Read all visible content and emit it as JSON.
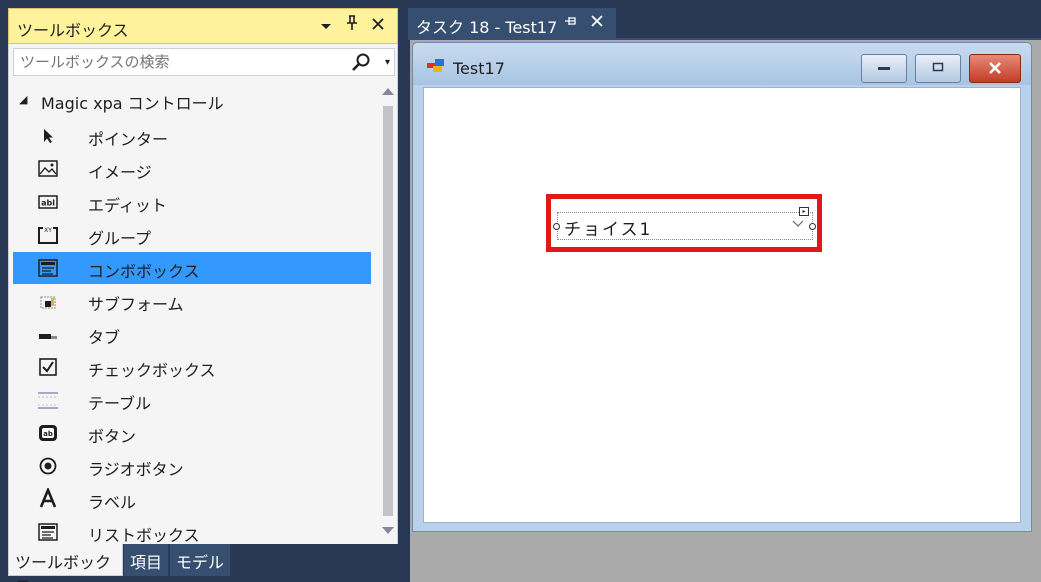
{
  "toolbox": {
    "title": "ツールボックス",
    "search_placeholder": "ツールボックスの検索",
    "group_label": "Magic xpa コントロール",
    "items": [
      {
        "label": "ポインター",
        "icon": "pointer-icon",
        "selected": false
      },
      {
        "label": "イメージ",
        "icon": "image-icon",
        "selected": false
      },
      {
        "label": "エディット",
        "icon": "edit-icon",
        "selected": false
      },
      {
        "label": "グループ",
        "icon": "group-icon",
        "selected": false
      },
      {
        "label": "コンボボックス",
        "icon": "combobox-icon",
        "selected": true
      },
      {
        "label": "サブフォーム",
        "icon": "subform-icon",
        "selected": false
      },
      {
        "label": "タブ",
        "icon": "tab-icon",
        "selected": false
      },
      {
        "label": "チェックボックス",
        "icon": "checkbox-icon",
        "selected": false
      },
      {
        "label": "テーブル",
        "icon": "table-icon",
        "selected": false
      },
      {
        "label": "ボタン",
        "icon": "button-icon",
        "selected": false
      },
      {
        "label": "ラジオボタン",
        "icon": "radio-button-icon",
        "selected": false
      },
      {
        "label": "ラベル",
        "icon": "label-icon",
        "selected": false
      },
      {
        "label": "リストボックス",
        "icon": "listbox-icon",
        "selected": false
      }
    ],
    "bottom_tabs": [
      "ツールボックス",
      "項目",
      "モデル"
    ]
  },
  "document": {
    "tab_title": "タスク 18 - Test17"
  },
  "form": {
    "title": "Test17",
    "combo_value": "チョイス1"
  },
  "colors": {
    "background": "#293955",
    "toolbox_title_bg": "#fff29d",
    "selected_item": "#3399ff",
    "highlight_border": "#e01818",
    "close_button": "#c43c26"
  }
}
